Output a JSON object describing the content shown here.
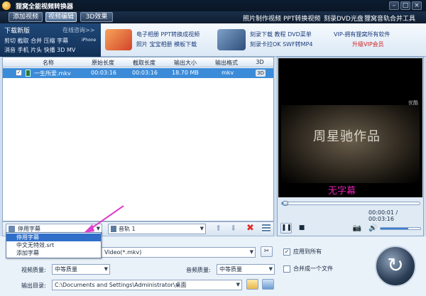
{
  "app": {
    "title": "狸窝全能视频转换器"
  },
  "menubar": {
    "buttons": [
      "添加视频",
      "视频编辑",
      "3D效果"
    ],
    "links": [
      "照片制作视频",
      "PPT转换视频",
      "刻录DVD光盘",
      "狸窝音轨合并工具"
    ]
  },
  "banner": {
    "download_title": "下载新版",
    "online_help": "在线咨询>>",
    "download_items_1": "剪切 截取 合并 压缩 字幕",
    "download_items_1_tail": "iPhone",
    "download_items_2": "消音 手机 片头 快播 3D MV",
    "promo1_line1": "电子相册 PPT转换成视频",
    "promo1_line2": "照片 宝宝相册 模板下载",
    "promo2_line1": "刻录下载 教程 DVD菜单",
    "promo2_line2": "刻录卡拉OK SWF转MP4",
    "vip_line1": "VIP-拥有狸窝所有软件",
    "vip_line2": "升级VIP会员"
  },
  "table": {
    "headers": [
      "名称",
      "原始长度",
      "截取长度",
      "输出大小",
      "输出格式",
      "3D"
    ],
    "rows": [
      {
        "name": "一生所爱.mkv",
        "orig": "00:03:16",
        "cut": "00:03:16",
        "size": "18.70 MB",
        "format": "mkv"
      }
    ]
  },
  "preview": {
    "watermark": "优酷",
    "subtitle": "无字幕",
    "scene_text": "周星驰作品",
    "time": "00:00:01 / 00:03:16",
    "progress": 0.01,
    "volume": 0.7
  },
  "bottom": {
    "subtitle_value": "停用字幕",
    "audio_track": "音轨 1"
  },
  "dropdown": {
    "options": [
      "停用字幕",
      "中文无特效.srt",
      "添加字幕"
    ],
    "selected_index": 0
  },
  "settings": {
    "format_partial": "Video(*.mkv)",
    "apply_all": "应用到所有",
    "video_quality_label": "视频质量:",
    "video_quality": "中等质量",
    "audio_quality_label": "音频质量:",
    "audio_quality": "中等质量",
    "merge_label": "合并成一个文件",
    "output_label": "输出目录:",
    "output_path": "C:\\Documents and Settings\\Administrator\\桌面"
  },
  "colors": {
    "accent": "#2f6fc9",
    "row_selected": "#3b8bd9",
    "arrow": "#e040c8",
    "subtitle": "#e020b0",
    "vip": "#d02020"
  }
}
